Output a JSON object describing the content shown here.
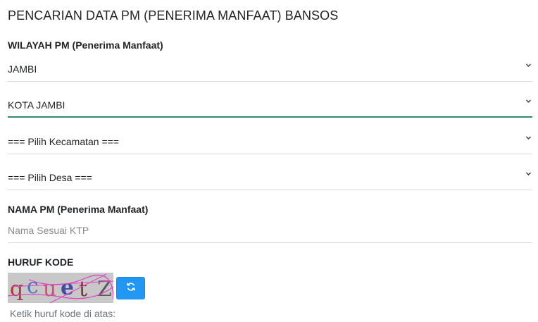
{
  "page": {
    "title": "PENCARIAN DATA PM (PENERIMA MANFAAT) BANSOS"
  },
  "wilayah": {
    "label": "WILAYAH PM (Penerima Manfaat)",
    "provinsi": "JAMBI",
    "kabupaten": "KOTA JAMBI",
    "kecamatan": "=== Pilih Kecamatan ===",
    "desa": "=== Pilih Desa ==="
  },
  "nama": {
    "label": "NAMA PM (Penerima Manfaat)",
    "value": "",
    "placeholder": "Nama Sesuai KTP"
  },
  "captcha": {
    "label": "HURUF KODE",
    "code": "qcuetZ",
    "hint": "Ketik huruf kode di atas:"
  },
  "colors": {
    "accent_focus": "#2e8b6e",
    "button_blue": "#2196f3"
  },
  "icons": {
    "select_arrow": "chevron-down-icon",
    "refresh": "refresh-icon"
  }
}
